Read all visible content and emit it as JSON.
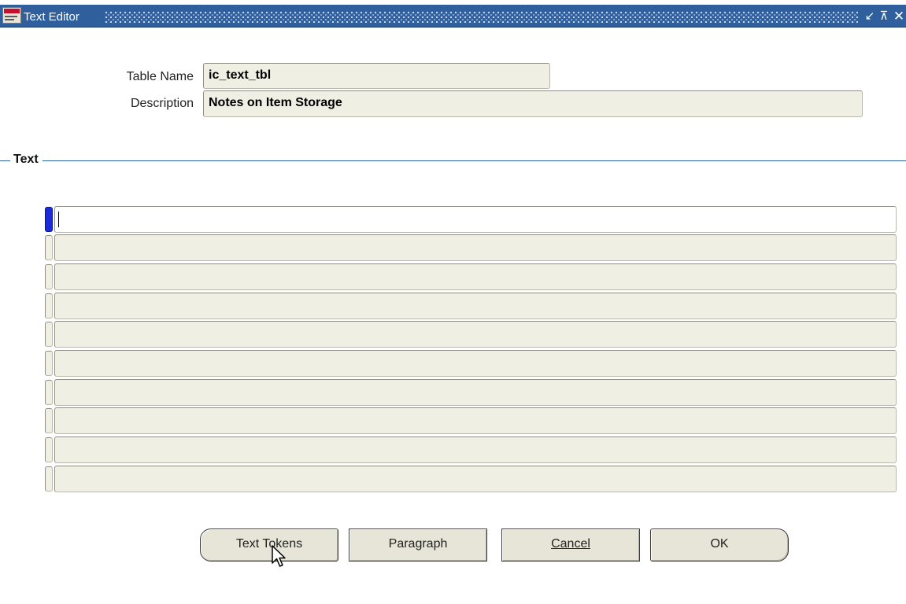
{
  "window": {
    "title": "Text Editor",
    "icon": "oracle-app-icon",
    "controls": {
      "minimize": "↙",
      "maximize": "⊼",
      "close": "✕"
    }
  },
  "form": {
    "table_name": {
      "label": "Table Name",
      "value": "ic_text_tbl"
    },
    "description": {
      "label": "Description",
      "value": "Notes on Item Storage"
    }
  },
  "text_section": {
    "title": "Text",
    "rows": [
      "",
      "",
      "",
      "",
      "",
      "",
      "",
      "",
      "",
      ""
    ],
    "current_row": 0
  },
  "buttons": {
    "text_tokens": "Text Tokens",
    "paragraph": "Paragraph",
    "cancel": "Cancel",
    "ok": "OK"
  },
  "colors": {
    "titlebar": "#2f5f9c",
    "field_bg": "#f0efe4",
    "button_bg": "#e6e5d7",
    "row_indicator_active": "#1b2bd8"
  }
}
